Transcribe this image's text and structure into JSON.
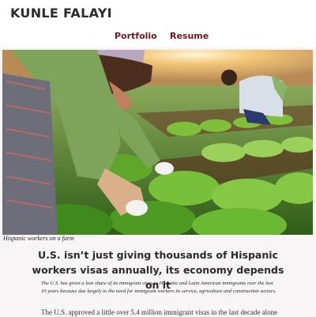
{
  "site": {
    "title": "KUNLE FALAYI"
  },
  "nav": {
    "items": [
      {
        "label": "Portfolio"
      },
      {
        "label": "Resume"
      }
    ]
  },
  "article": {
    "image_caption": "Hispanic workers on a farm",
    "headline": "U.S. isn’t just giving thousands of Hispanic workers visas annually, its economy depends on it",
    "lede": "The U.S. has given a lion share of its immigrant visas to Hispanic and Latin American immigrants over the last 10 years because due largely to the need for immigrant workers its service, agriculture and construction sectors.",
    "body_first_line": "The U.S. approved a little over 5.4 million immigrant visas in the last decade alone"
  },
  "colors": {
    "nav_link": "#7a1416",
    "background": "#f7f5f5"
  }
}
